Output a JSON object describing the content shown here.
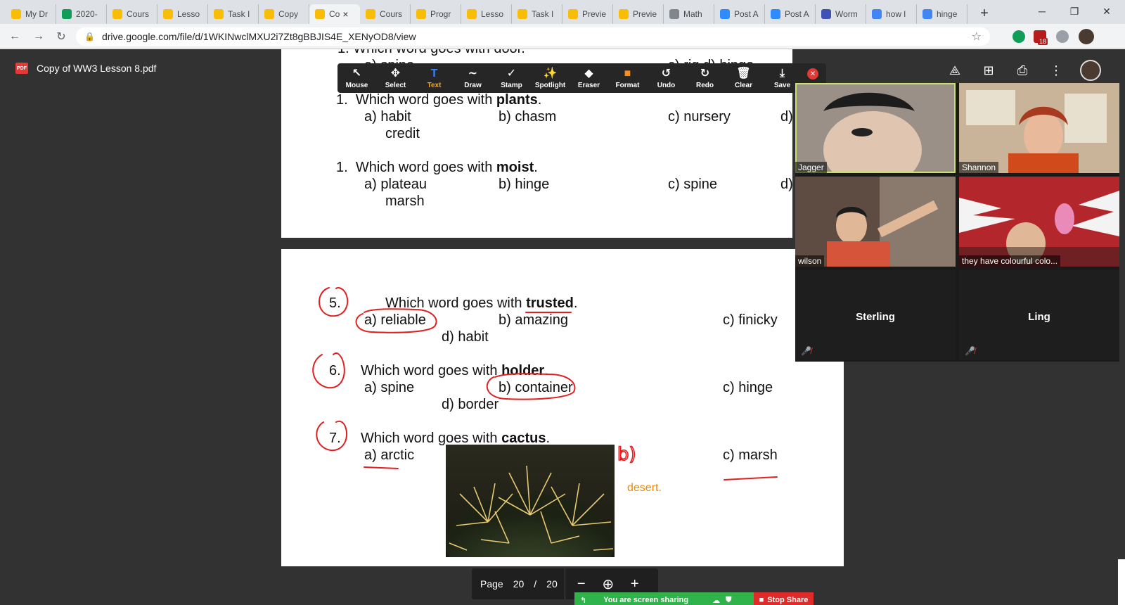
{
  "browser": {
    "tabs": [
      {
        "label": "My Dr",
        "icon": "google-drive-icon",
        "color": "#fbbc04"
      },
      {
        "label": "2020-",
        "icon": "google-sheets-icon",
        "color": "#0f9d58"
      },
      {
        "label": "Cours",
        "icon": "classroom-icon",
        "color": "#fbbc04"
      },
      {
        "label": "Lesso",
        "icon": "classroom-icon",
        "color": "#fbbc04"
      },
      {
        "label": "Task I",
        "icon": "classroom-icon",
        "color": "#fbbc04"
      },
      {
        "label": "Copy",
        "icon": "google-drive-icon",
        "color": "#fbbc04"
      },
      {
        "label": "Co",
        "icon": "google-drive-icon",
        "color": "#fbbc04"
      },
      {
        "label": "Cours",
        "icon": "classroom-icon",
        "color": "#fbbc04"
      },
      {
        "label": "Progr",
        "icon": "classroom-icon",
        "color": "#fbbc04"
      },
      {
        "label": "Lesso",
        "icon": "classroom-icon",
        "color": "#fbbc04"
      },
      {
        "label": "Task I",
        "icon": "classroom-icon",
        "color": "#fbbc04"
      },
      {
        "label": "Previe",
        "icon": "classroom-icon",
        "color": "#fbbc04"
      },
      {
        "label": "Previe",
        "icon": "classroom-icon",
        "color": "#fbbc04"
      },
      {
        "label": "Math",
        "icon": "globe-icon",
        "color": "#80868b"
      },
      {
        "label": "Post A",
        "icon": "zoom-icon",
        "color": "#2d8cff"
      },
      {
        "label": "Post A",
        "icon": "zoom-icon",
        "color": "#2d8cff"
      },
      {
        "label": "Worm",
        "icon": "dictionary-icon",
        "color": "#3f51b5"
      },
      {
        "label": "how l",
        "icon": "google-icon",
        "color": "#4285f4"
      },
      {
        "label": "hinge",
        "icon": "google-icon",
        "color": "#4285f4"
      }
    ],
    "active_tab_index": 6,
    "url": "drive.google.com/file/d/1WKINwclMXU2i7Zt8gBBJIS4E_XENyOD8/view",
    "ext_badge": "18",
    "colors": {
      "tabstrip": "#dee1e6",
      "toolbar": "#f1f3f4"
    }
  },
  "drive": {
    "filename": "Copy of WW3 Lesson 8.pdf",
    "pdf_badge": "PDF"
  },
  "pdf": {
    "top_partial": "1.  Which word goes with door.",
    "top_partial_opts": "a)  spine",
    "top_partial_right": "c) rig      d) hinge",
    "q_plants": {
      "num": "1.",
      "pre": "Which word goes with ",
      "bold": "plants",
      "post": ".",
      "a": "a)  habit",
      "b": "b) chasm",
      "c": "c) nursery",
      "d": "d)",
      "d2": "credit"
    },
    "q_moist": {
      "num": "1.",
      "pre": "Which word goes with ",
      "bold": "moist",
      "post": ".",
      "a": "a)  plateau",
      "b": "b) hinge",
      "c": "c) spine",
      "d": "d)",
      "d2": "marsh"
    },
    "q5": {
      "num": "5.",
      "pre": "Which word goes with ",
      "bold": "trusted",
      "post": ".",
      "a": "a)  reliable",
      "b": "b) amazing",
      "c": "c) finicky",
      "d": "d) habit"
    },
    "q6": {
      "num": "6.",
      "pre": "Which word goes with ",
      "bold": "holder",
      "post": ".",
      "a": "a)  spine",
      "b": "b) container",
      "c": "c) hinge",
      "d": "d) border"
    },
    "q7": {
      "num": "7.",
      "pre": "Which word goes with ",
      "bold": "cactus",
      "post": ".",
      "a": "a)  arctic",
      "b_annot": "b)",
      "c": "c) marsh",
      "typed": "desert."
    },
    "annotation_color": "#e02020",
    "typed_color": "#f08a00"
  },
  "annotate_toolbar": {
    "tools": [
      {
        "label": "Mouse",
        "icon": "cursor-icon",
        "glyph": "↖"
      },
      {
        "label": "Select",
        "icon": "move-icon",
        "glyph": "✥"
      },
      {
        "label": "Text",
        "icon": "text-icon",
        "glyph": "T",
        "active": true
      },
      {
        "label": "Draw",
        "icon": "draw-icon",
        "glyph": "∼"
      },
      {
        "label": "Stamp",
        "icon": "stamp-icon",
        "glyph": "✓"
      },
      {
        "label": "Spotlight",
        "icon": "spotlight-icon",
        "glyph": "✨"
      },
      {
        "label": "Eraser",
        "icon": "eraser-icon",
        "glyph": "◆"
      },
      {
        "label": "Format",
        "icon": "format-icon",
        "glyph": "■"
      },
      {
        "label": "Undo",
        "icon": "undo-icon",
        "glyph": "↺"
      },
      {
        "label": "Redo",
        "icon": "redo-icon",
        "glyph": "↻"
      },
      {
        "label": "Clear",
        "icon": "trash-icon",
        "glyph": "🗑"
      },
      {
        "label": "Save",
        "icon": "save-icon",
        "glyph": "⤓"
      }
    ],
    "format_color": "#ff8c1a"
  },
  "gallery": {
    "video": [
      {
        "name": "Jagger",
        "bg": "#9a9088",
        "speaking": true
      },
      {
        "name": "Shannon",
        "bg": "#c9b49a"
      },
      {
        "name": "wilson",
        "bg": "#5e4c42"
      },
      {
        "name": "they have colourful colo...",
        "bg": "#b3262b"
      }
    ],
    "audio": [
      {
        "name": "Sterling"
      },
      {
        "name": "Ling"
      }
    ]
  },
  "page_control": {
    "label": "Page",
    "current": "20",
    "sep": "/",
    "total": "20"
  },
  "share_bar": {
    "status": "You are screen sharing",
    "stop": "Stop Share"
  }
}
